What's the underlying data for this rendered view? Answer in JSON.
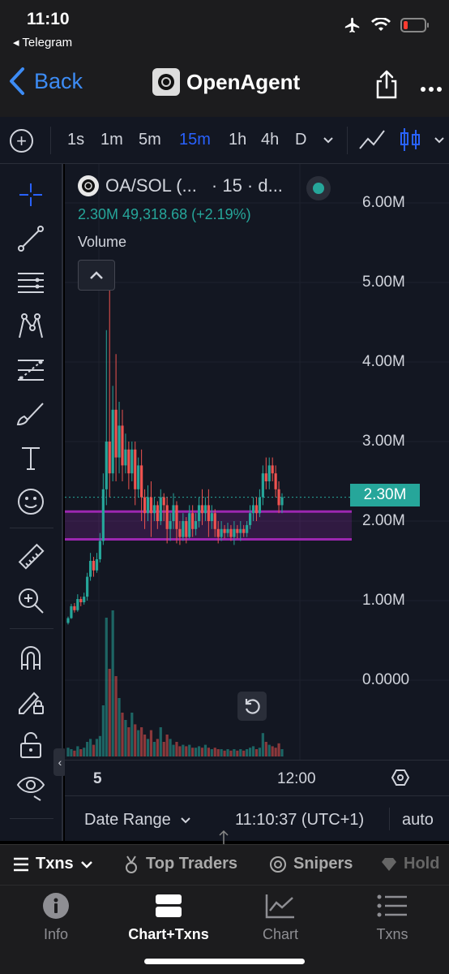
{
  "status_bar": {
    "time": "11:10",
    "back_app": "◂ Telegram"
  },
  "nav": {
    "back_label": "Back",
    "title": "OpenAgent"
  },
  "timeframes": [
    {
      "label": "1s",
      "active": false
    },
    {
      "label": "1m",
      "active": false
    },
    {
      "label": "5m",
      "active": false
    },
    {
      "label": "15m",
      "active": true
    },
    {
      "label": "1h",
      "active": false
    },
    {
      "label": "4h",
      "active": false
    },
    {
      "label": "D",
      "active": false
    }
  ],
  "legend": {
    "pair": "OA/SOL (...",
    "interval": "· 15 · d...",
    "values": "2.30M  49,318.68 (+2.19%)",
    "volume_label": "Volume"
  },
  "price_axis": [
    "6.00M",
    "5.00M",
    "4.00M",
    "3.00M",
    "2.00M",
    "1.00M",
    "0.0000"
  ],
  "last_price": "2.30M",
  "time_axis": {
    "day": "5",
    "time": "12:00"
  },
  "bottom_bar": {
    "date_range": "Date Range",
    "clock": "11:10:37 (UTC+1)",
    "scale": "auto"
  },
  "tx_tabs": [
    {
      "label": "Txns",
      "active": true
    },
    {
      "label": "Top Traders",
      "active": false
    },
    {
      "label": "Snipers",
      "active": false
    },
    {
      "label": "Hold",
      "active": false
    }
  ],
  "bottom_nav": [
    {
      "label": "Info",
      "icon": "info-icon",
      "active": false
    },
    {
      "label": "Chart+Txns",
      "icon": "chart-txns-icon",
      "active": true
    },
    {
      "label": "Chart",
      "icon": "chart-icon",
      "active": false
    },
    {
      "label": "Txns",
      "icon": "list-icon",
      "active": false
    }
  ],
  "colors": {
    "up": "#26a69a",
    "down": "#ef5350",
    "accent": "#2962ff",
    "zone": "#9c27b0",
    "background": "#131722"
  },
  "chart_data": {
    "type": "candlestick",
    "ylim": [
      -0.85,
      6.2
    ],
    "yticks": [
      6,
      5,
      4,
      3,
      2,
      1,
      0
    ],
    "y_unit": "M",
    "last_price": 2.3,
    "zone": [
      1.77,
      2.12
    ],
    "candles": [
      [
        0.72,
        0.78,
        0.7,
        0.8
      ],
      [
        0.78,
        0.93,
        0.77,
        0.96
      ],
      [
        0.93,
        0.88,
        0.85,
        0.97
      ],
      [
        0.88,
        1.02,
        0.86,
        1.08
      ],
      [
        1.02,
        0.98,
        0.93,
        1.05
      ],
      [
        0.98,
        1.05,
        0.95,
        1.1
      ],
      [
        1.05,
        1.3,
        1.0,
        1.35
      ],
      [
        1.3,
        1.5,
        1.25,
        1.6
      ],
      [
        1.5,
        1.38,
        1.3,
        1.55
      ],
      [
        1.38,
        1.52,
        1.35,
        1.6
      ],
      [
        1.52,
        1.75,
        1.48,
        1.85
      ],
      [
        1.75,
        2.4,
        1.7,
        2.6
      ],
      [
        2.4,
        3.0,
        2.2,
        4.4
      ],
      [
        3.0,
        2.6,
        2.3,
        5.0
      ],
      [
        2.6,
        3.4,
        2.5,
        3.7
      ],
      [
        3.4,
        2.8,
        2.5,
        4.1
      ],
      [
        2.8,
        3.2,
        2.6,
        3.5
      ],
      [
        3.2,
        2.7,
        2.5,
        3.4
      ],
      [
        2.7,
        2.9,
        2.6,
        3.1
      ],
      [
        2.9,
        2.6,
        2.4,
        3.0
      ],
      [
        2.6,
        2.9,
        2.5,
        3.0
      ],
      [
        2.9,
        2.4,
        2.2,
        3.0
      ],
      [
        2.4,
        2.7,
        2.3,
        2.8
      ],
      [
        2.7,
        2.3,
        2.0,
        2.9
      ],
      [
        2.3,
        2.1,
        1.9,
        2.4
      ],
      [
        2.1,
        2.3,
        2.0,
        2.45
      ],
      [
        2.3,
        2.1,
        1.8,
        2.5
      ],
      [
        2.1,
        2.2,
        2.0,
        2.3
      ],
      [
        2.2,
        2.0,
        1.9,
        2.25
      ],
      [
        2.0,
        2.3,
        1.95,
        2.4
      ],
      [
        2.3,
        2.2,
        2.0,
        2.35
      ],
      [
        2.2,
        1.9,
        1.72,
        2.3
      ],
      [
        1.9,
        2.0,
        1.75,
        2.1
      ],
      [
        2.0,
        2.2,
        1.9,
        2.35
      ],
      [
        2.2,
        1.9,
        1.72,
        2.25
      ],
      [
        1.9,
        1.8,
        1.7,
        2.0
      ],
      [
        1.8,
        2.0,
        1.75,
        2.1
      ],
      [
        2.0,
        1.8,
        1.72,
        2.05
      ],
      [
        1.8,
        2.1,
        1.78,
        2.2
      ],
      [
        2.1,
        1.9,
        1.8,
        2.2
      ],
      [
        1.9,
        2.0,
        1.82,
        2.1
      ],
      [
        2.0,
        2.2,
        1.92,
        2.3
      ],
      [
        2.2,
        2.1,
        1.95,
        2.4
      ],
      [
        2.1,
        2.2,
        2.0,
        2.3
      ],
      [
        2.2,
        2.0,
        1.8,
        2.4
      ],
      [
        2.0,
        2.1,
        1.9,
        2.2
      ],
      [
        2.1,
        1.9,
        1.8,
        2.15
      ],
      [
        1.9,
        1.8,
        1.72,
        2.0
      ],
      [
        1.8,
        1.9,
        1.75,
        2.0
      ],
      [
        1.9,
        1.85,
        1.78,
        1.95
      ],
      [
        1.85,
        1.9,
        1.8,
        1.98
      ],
      [
        1.9,
        1.8,
        1.75,
        1.95
      ],
      [
        1.8,
        1.9,
        1.7,
        2.0
      ],
      [
        1.9,
        1.85,
        1.78,
        1.95
      ],
      [
        1.85,
        1.9,
        1.75,
        2.0
      ],
      [
        1.9,
        1.85,
        1.8,
        1.95
      ],
      [
        1.85,
        1.95,
        1.8,
        2.0
      ],
      [
        1.95,
        2.1,
        1.9,
        2.2
      ],
      [
        2.1,
        2.2,
        2.0,
        2.3
      ],
      [
        2.2,
        2.1,
        2.0,
        2.3
      ],
      [
        2.1,
        2.3,
        2.05,
        2.4
      ],
      [
        2.3,
        2.6,
        2.2,
        2.7
      ],
      [
        2.6,
        2.5,
        2.4,
        2.8
      ],
      [
        2.5,
        2.7,
        2.4,
        2.8
      ],
      [
        2.7,
        2.6,
        2.5,
        2.8
      ],
      [
        2.6,
        2.4,
        2.3,
        2.7
      ],
      [
        2.4,
        2.2,
        2.1,
        2.5
      ],
      [
        2.2,
        2.3,
        2.1,
        2.35
      ]
    ],
    "volumes": [
      0.06,
      0.05,
      0.04,
      0.07,
      0.05,
      0.06,
      0.1,
      0.12,
      0.08,
      0.12,
      0.14,
      0.35,
      0.95,
      0.6,
      1.0,
      0.55,
      0.4,
      0.3,
      0.25,
      0.2,
      0.3,
      0.22,
      0.18,
      0.2,
      0.15,
      0.12,
      0.18,
      0.1,
      0.12,
      0.2,
      0.1,
      0.15,
      0.12,
      0.08,
      0.1,
      0.07,
      0.08,
      0.07,
      0.08,
      0.06,
      0.06,
      0.07,
      0.06,
      0.08,
      0.06,
      0.05,
      0.06,
      0.05,
      0.05,
      0.04,
      0.05,
      0.04,
      0.05,
      0.04,
      0.05,
      0.04,
      0.05,
      0.06,
      0.07,
      0.05,
      0.06,
      0.16,
      0.1,
      0.08,
      0.07,
      0.06,
      0.09,
      0.05
    ]
  }
}
